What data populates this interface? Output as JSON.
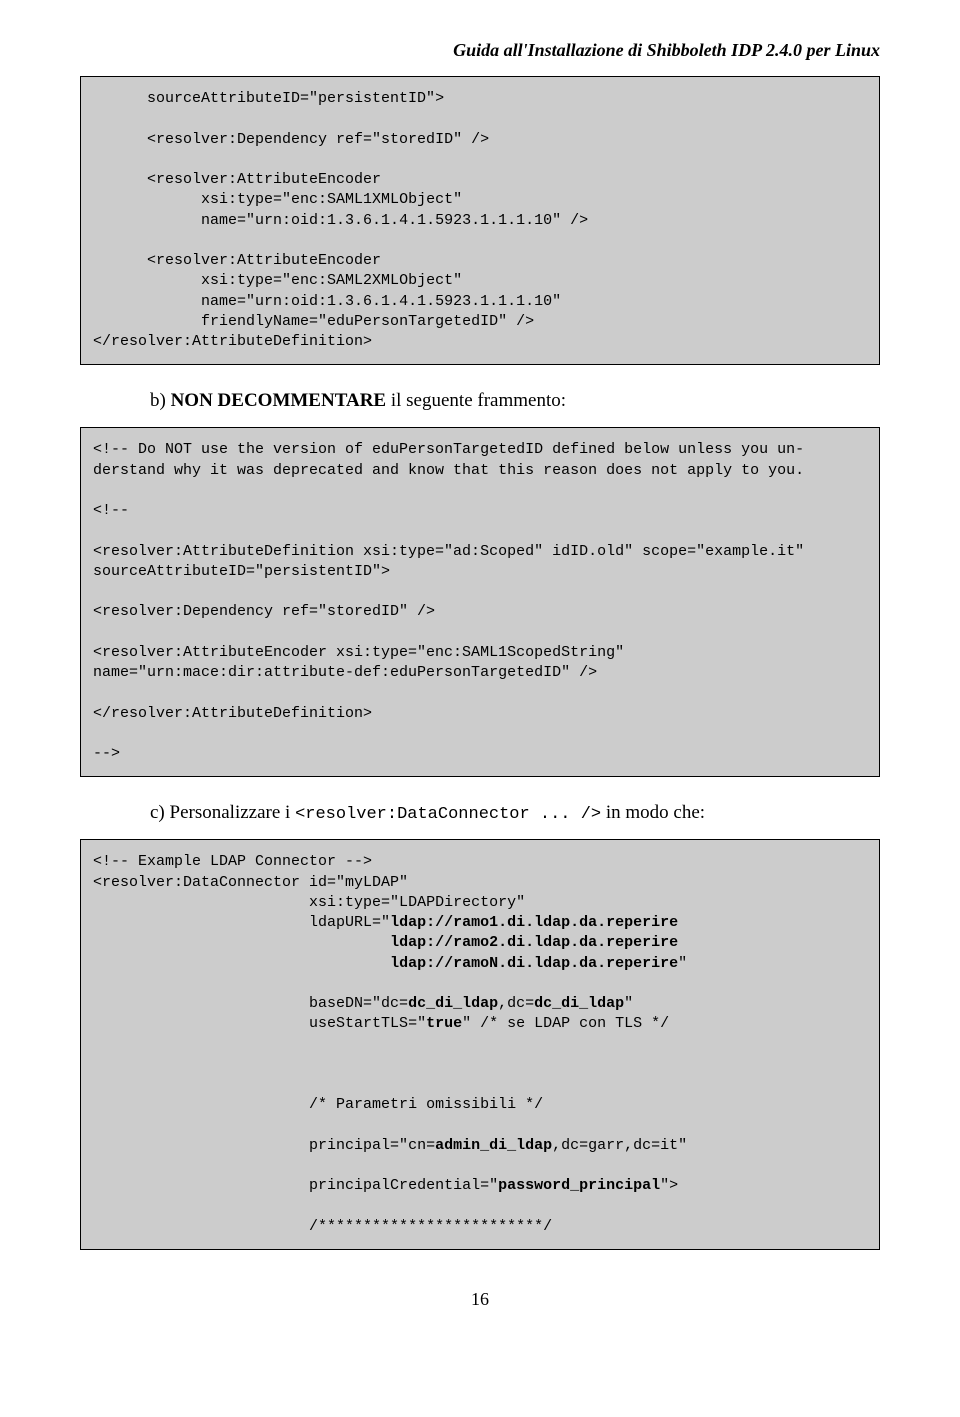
{
  "header": {
    "title": "Guida all'Installazione di Shibboleth IDP 2.4.0 per Linux"
  },
  "block1": {
    "code": "      sourceAttributeID=\"persistentID\">\n\n      <resolver:Dependency ref=\"storedID\" />\n\n      <resolver:AttributeEncoder\n            xsi:type=\"enc:SAML1XMLObject\"\n            name=\"urn:oid:1.3.6.1.4.1.5923.1.1.1.10\" />\n\n      <resolver:AttributeEncoder\n            xsi:type=\"enc:SAML2XMLObject\"\n            name=\"urn:oid:1.3.6.1.4.1.5923.1.1.1.10\"\n            friendlyName=\"eduPersonTargetedID\" />\n</resolver:AttributeDefinition>"
  },
  "item_b": {
    "prefix": "b)  ",
    "bold": "NON DECOMMENTARE",
    "suffix": " il seguente frammento:"
  },
  "block2": {
    "code": "<!-- Do NOT use the version of eduPersonTargetedID defined below unless you un-\nderstand why it was deprecated and know that this reason does not apply to you.\n\n<!--\n\n<resolver:AttributeDefinition xsi:type=\"ad:Scoped\" idID.old\" scope=\"example.it\"\nsourceAttributeID=\"persistentID\">\n\n<resolver:Dependency ref=\"storedID\" />\n\n<resolver:AttributeEncoder xsi:type=\"enc:SAML1ScopedString\"\nname=\"urn:mace:dir:attribute-def:eduPersonTargetedID\" />\n\n</resolver:AttributeDefinition>\n\n-->"
  },
  "item_c": {
    "prefix": "c)  Personalizzare i ",
    "code": "<resolver:DataConnector ... />",
    "suffix": " in modo che:"
  },
  "block3": {
    "line1": "<!-- Example LDAP Connector -->",
    "line2": "<resolver:DataConnector id=\"myLDAP\"",
    "line3": "                        xsi:type=\"LDAPDirectory\"",
    "line4a": "                        ldapURL=\"",
    "line4b": "ldap://ramo1.di.ldap.da.reperire",
    "line5": "                                 ldap://ramo2.di.ldap.da.reperire",
    "line6a": "                                 ldap://ramoN.di.ldap.da.reperire",
    "line6q": "\"",
    "line7a": "                        baseDN=\"dc=",
    "line7b": "dc_di_ldap",
    "line7c": ",dc=",
    "line7d": "dc_di_ldap",
    "line7e": "\"",
    "line8a": "                        useStartTLS=\"",
    "line8b": "true",
    "line8c": "\" /* se LDAP con TLS */",
    "line9": "                        /* Parametri omissibili */",
    "line10a": "                        principal=\"cn=",
    "line10b": "admin_di_ldap",
    "line10c": ",dc=garr,dc=it\"",
    "line11a": "                        principalCredential=\"",
    "line11b": "password_principal",
    "line11c": "\">",
    "line12": "                        /*************************/"
  },
  "footer": {
    "page": "16"
  }
}
